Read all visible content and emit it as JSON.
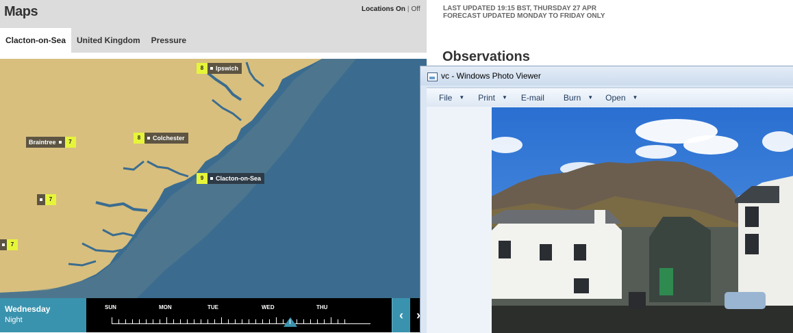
{
  "maps": {
    "title": "Maps",
    "locations_label": "Locations On",
    "locations_off_label": "Off",
    "tabs": [
      {
        "label": "Clacton-on-Sea",
        "active": true
      },
      {
        "label": "United Kingdom",
        "active": false
      },
      {
        "label": "Pressure",
        "active": false
      }
    ],
    "locations": [
      {
        "name": "Ipswich",
        "temp": "8"
      },
      {
        "name": "Braintree",
        "temp": "7"
      },
      {
        "name": "Colchester",
        "temp": "8"
      },
      {
        "name": "Clacton-on-Sea",
        "temp": "9"
      },
      {
        "name": "",
        "temp": "7"
      },
      {
        "name": "",
        "temp": "7"
      }
    ],
    "colors": {
      "land": "#d8bf7e",
      "sea": "#3b6c8f",
      "temp_badge": "#e6f53a",
      "timeline_accent": "#3a93ae"
    }
  },
  "timeline": {
    "day": "Wednesday",
    "period": "Night",
    "days": [
      "SUN",
      "MON",
      "TUE",
      "WED",
      "THU"
    ],
    "prev_icon": "chevron-left-icon",
    "next_icon": "chevron-right-icon"
  },
  "page": {
    "last_updated": "LAST UPDATED 19:15 BST, THURSDAY 27 APR",
    "forecast_note": "FORECAST UPDATED MONDAY TO FRIDAY ONLY",
    "observations_title": "Observations"
  },
  "viewer": {
    "title": "vc - Windows Photo Viewer",
    "menu": [
      {
        "label": "File",
        "has_dropdown": true
      },
      {
        "label": "Print",
        "has_dropdown": true
      },
      {
        "label": "E-mail",
        "has_dropdown": false
      },
      {
        "label": "Burn",
        "has_dropdown": true
      },
      {
        "label": "Open",
        "has_dropdown": true
      }
    ]
  }
}
